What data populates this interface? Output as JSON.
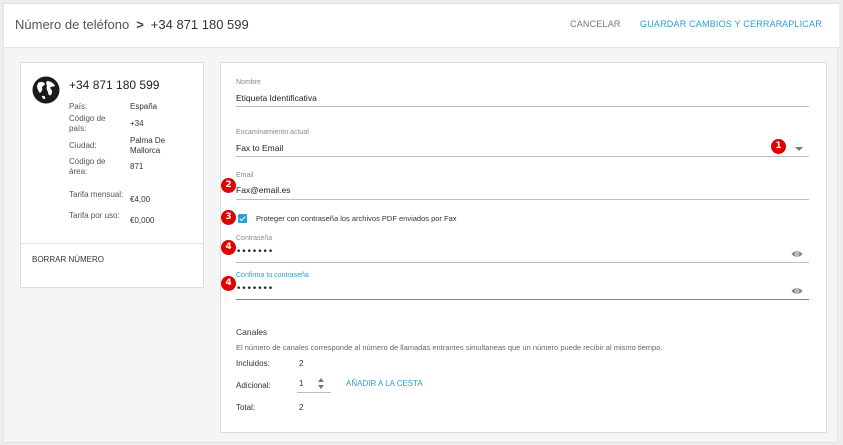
{
  "header": {
    "breadcrumb_parent": "Número de teléfono",
    "breadcrumb_separator": ">",
    "breadcrumb_current": "+34 871 180 599",
    "cancel_label": "CANCELAR",
    "save_label": "GUARDAR CAMBIOS Y CERRAR",
    "apply_label": "APLICAR"
  },
  "number_card": {
    "number": "+34 871 180 599",
    "icon": "globe-icon",
    "details": [
      {
        "label": "País:",
        "value": "España"
      },
      {
        "label": "Código de país:",
        "value": "+34"
      },
      {
        "label": "Ciudad:",
        "value": "Palma De Mallorca"
      },
      {
        "label": "Código de área:",
        "value": "871"
      },
      {
        "label": "Tarifa mensual:",
        "value": "€4,00"
      },
      {
        "label": "Tarifa por uso:",
        "value": "€0,000"
      }
    ],
    "delete_label": "BORRAR NÚMERO"
  },
  "form": {
    "name_label": "Nombre",
    "name_value": "Etiqueta Identificativa",
    "routing_label": "Encaminamiento actual",
    "routing_value": "Fax to Email",
    "email_label": "Email",
    "email_value": "Fax@email.es",
    "protect_checked": true,
    "protect_label": "Proteger con contraseña los archivos PDF enviados por Fax",
    "password_label": "Contraseña",
    "password_value": "•••••••",
    "confirm_label": "Confirma tu contraseña",
    "confirm_value": "•••••••"
  },
  "annotations": {
    "badge_1": "1",
    "badge_2": "2",
    "badge_3": "3",
    "badge_4a": "4",
    "badge_4b": "4",
    "color": "#e00000"
  },
  "channels": {
    "title": "Canales",
    "description": "El número de canales corresponde al número de llamadas entrantes simultaneas que un número puede recibir al mismo tiempo.",
    "included_label": "Incluidos:",
    "included_value": "2",
    "additional_label": "Adicional:",
    "additional_value": "1",
    "add_cart_label": "AÑADIR A LA CESTA",
    "total_label": "Total:",
    "total_value": "2"
  },
  "colors": {
    "accent": "#2a9fd6",
    "background": "#f5f5f5"
  }
}
